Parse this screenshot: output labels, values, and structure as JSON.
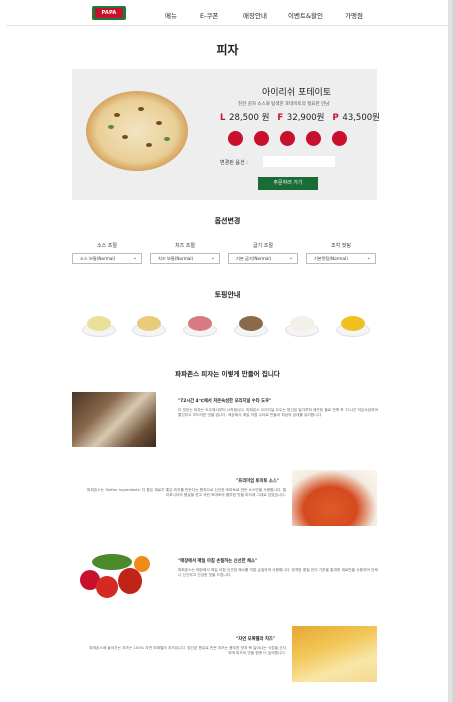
{
  "header": {
    "logo_text": "PAPA JOHNS",
    "nav": [
      "메뉴",
      "E-쿠폰",
      "매장안내",
      "이벤트&할인",
      "가맹점"
    ]
  },
  "page_title": "피자",
  "product": {
    "name": "아이리쉬 포테이토",
    "description": "진한 감자 소스와 탐색한 포테이토의 절묘한 만남",
    "prices": [
      {
        "size": "L",
        "price": "28,500 원"
      },
      {
        "size": "F",
        "price": "32,900원"
      },
      {
        "size": "P",
        "price": "43,500원"
      }
    ],
    "options_changed_label": "변경된 옵션 :",
    "order_button": "주문하러 가기"
  },
  "option_section": {
    "title": "옵션변경",
    "options": [
      {
        "label": "소스 조절",
        "value": "소스 보통(Normal)"
      },
      {
        "label": "치즈 조절",
        "value": "치즈 보통(Normal)"
      },
      {
        "label": "굽기 조절",
        "value": "기본 굽기(Normal)"
      },
      {
        "label": "조각 컷팅",
        "value": "기본컷팅(Normal)"
      }
    ]
  },
  "topping_section": {
    "title": "토핑안내",
    "toppings": [
      {
        "name": "cheese-topping",
        "color": "#e9de9a"
      },
      {
        "name": "potato-topping",
        "color": "#e8cc7a"
      },
      {
        "name": "ham-topping",
        "color": "#d97a82"
      },
      {
        "name": "mushroom-topping",
        "color": "#8a6a4a"
      },
      {
        "name": "onion-topping",
        "color": "#f3f0e8"
      },
      {
        "name": "corn-topping",
        "color": "#f0c020"
      }
    ]
  },
  "making_section": {
    "title": "파파존스 피자는 이렇게 만들어 집니다",
    "steps": [
      {
        "heading": "\"72시간 4℃에서 저온숙성한 오리지널 수타 도우\"",
        "text": "더 맛있는 피자는 도우에서부터 시작됩니다. 파파존스 오리지널 도우는 엄선된 밀가루와 깨끗한 물로 반죽 후 72시간 저온숙성하여 쫄깃하고 부드러운 맛을 냅니다. 매장에서 매일 직접 수타로 만들어 최상의 상태를 유지합니다."
      },
      {
        "heading": "\"프리미엄 토마토 소스\"",
        "text": "파파존스는 'Better Ingredients' 더 좋은 재료가 좋은 피자를 만든다는 원칙으로 신선한 토마토로 만든 소스만을 사용합니다. 캘리포니아의 햇살을 받고 자란 토마토의 풍부한 맛을 피자에 그대로 담았습니다."
      },
      {
        "heading": "\"매장에서 매일 아침 손질하는 신선한 채소\"",
        "text": "파파존스는 매장에서 매일 아침 신선한 채소를 직접 손질하여 사용합니다. 엄격한 품질 관리 기준을 통과한 재료만을 사용하여 언제나 신선하고 건강한 맛을 드립니다."
      },
      {
        "heading": "\"자연 모짜렐라 치즈\"",
        "text": "파파존스에 들어가는 치즈는 100% 자연 모짜렐라 치즈입니다. 엄선된 원유로 만든 치즈는 풍부한 맛과 쭉 늘어나는 식감을 선사하며 피자의 맛을 한층 더 높여줍니다."
      }
    ]
  },
  "colors": {
    "brand_red": "#c8102e",
    "brand_green": "#1a6b35",
    "panel_bg": "#eeeeee"
  }
}
